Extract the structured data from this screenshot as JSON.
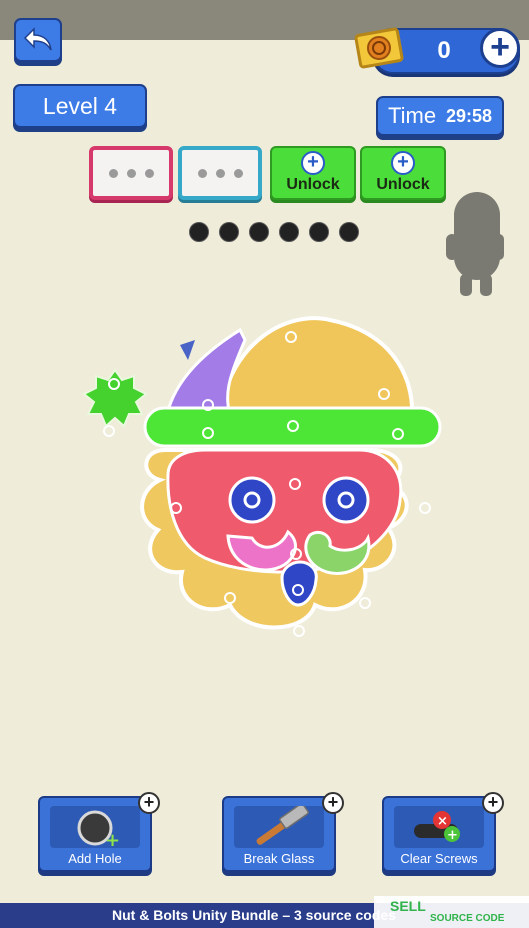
{
  "hud": {
    "coins": "0",
    "level_label": "Level 4",
    "time_label": "Time",
    "time_value": "29:58"
  },
  "slots": {
    "unlock_label": "Unlock"
  },
  "tools": {
    "add_hole": "Add Hole",
    "break_glass": "Break Glass",
    "clear_screws": "Clear Screws"
  },
  "footer": {
    "banner": "Nut & Bolts Unity Bundle – 3 source codes",
    "watermark": "SELL",
    "watermark_sub": "SOURCE CODE"
  },
  "icons": {
    "back": "back-arrow-icon",
    "coin": "coin-ticket-icon",
    "plus": "plus-icon",
    "hammer": "hammer-icon",
    "screws": "screws-icon",
    "hole": "hole-icon"
  },
  "colors": {
    "accent_blue": "#3d7be6",
    "unlock_green": "#4bde3a",
    "slot_pink": "#d63a6c",
    "slot_cyan": "#36a9c8"
  }
}
